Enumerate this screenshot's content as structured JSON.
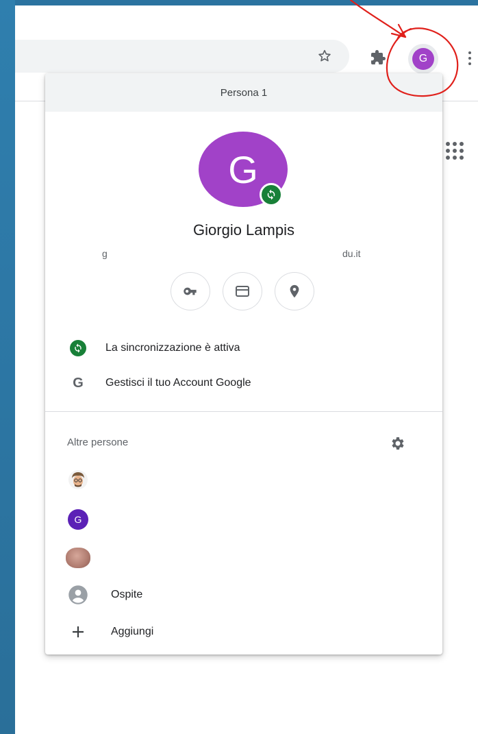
{
  "browser": {
    "profile_initial": "G",
    "icons": [
      "star-icon",
      "extensions-icon",
      "more-vert-icon",
      "apps-grid-icon"
    ]
  },
  "panel": {
    "header_title": "Persona 1",
    "avatar_initial": "G",
    "profile_name": "Giorgio Lampis",
    "email_visible_start": "g",
    "email_visible_end": "du.it",
    "quick_buttons": [
      "key-icon",
      "card-icon",
      "location-pin-icon"
    ],
    "sync_label": "La sincronizzazione è attiva",
    "manage_account_label": "Gestisci il tuo Account Google",
    "manage_account_icon_letter": "G",
    "other_people_label": "Altre persone",
    "other_people": [
      {
        "avatar": "cartoon-avatar-icon",
        "label": ""
      },
      {
        "avatar": "initial",
        "initial": "G",
        "label": ""
      },
      {
        "avatar": "photo-avatar-icon",
        "label": ""
      },
      {
        "avatar": "guest-icon",
        "label": "Ospite"
      },
      {
        "avatar": "add-icon",
        "label": "Aggiungi"
      }
    ]
  },
  "colors": {
    "profile_purple": "#a142c8",
    "sync_green": "#188038",
    "annotation_red": "#e0201b",
    "desktop_blue": "#2b73a0"
  }
}
